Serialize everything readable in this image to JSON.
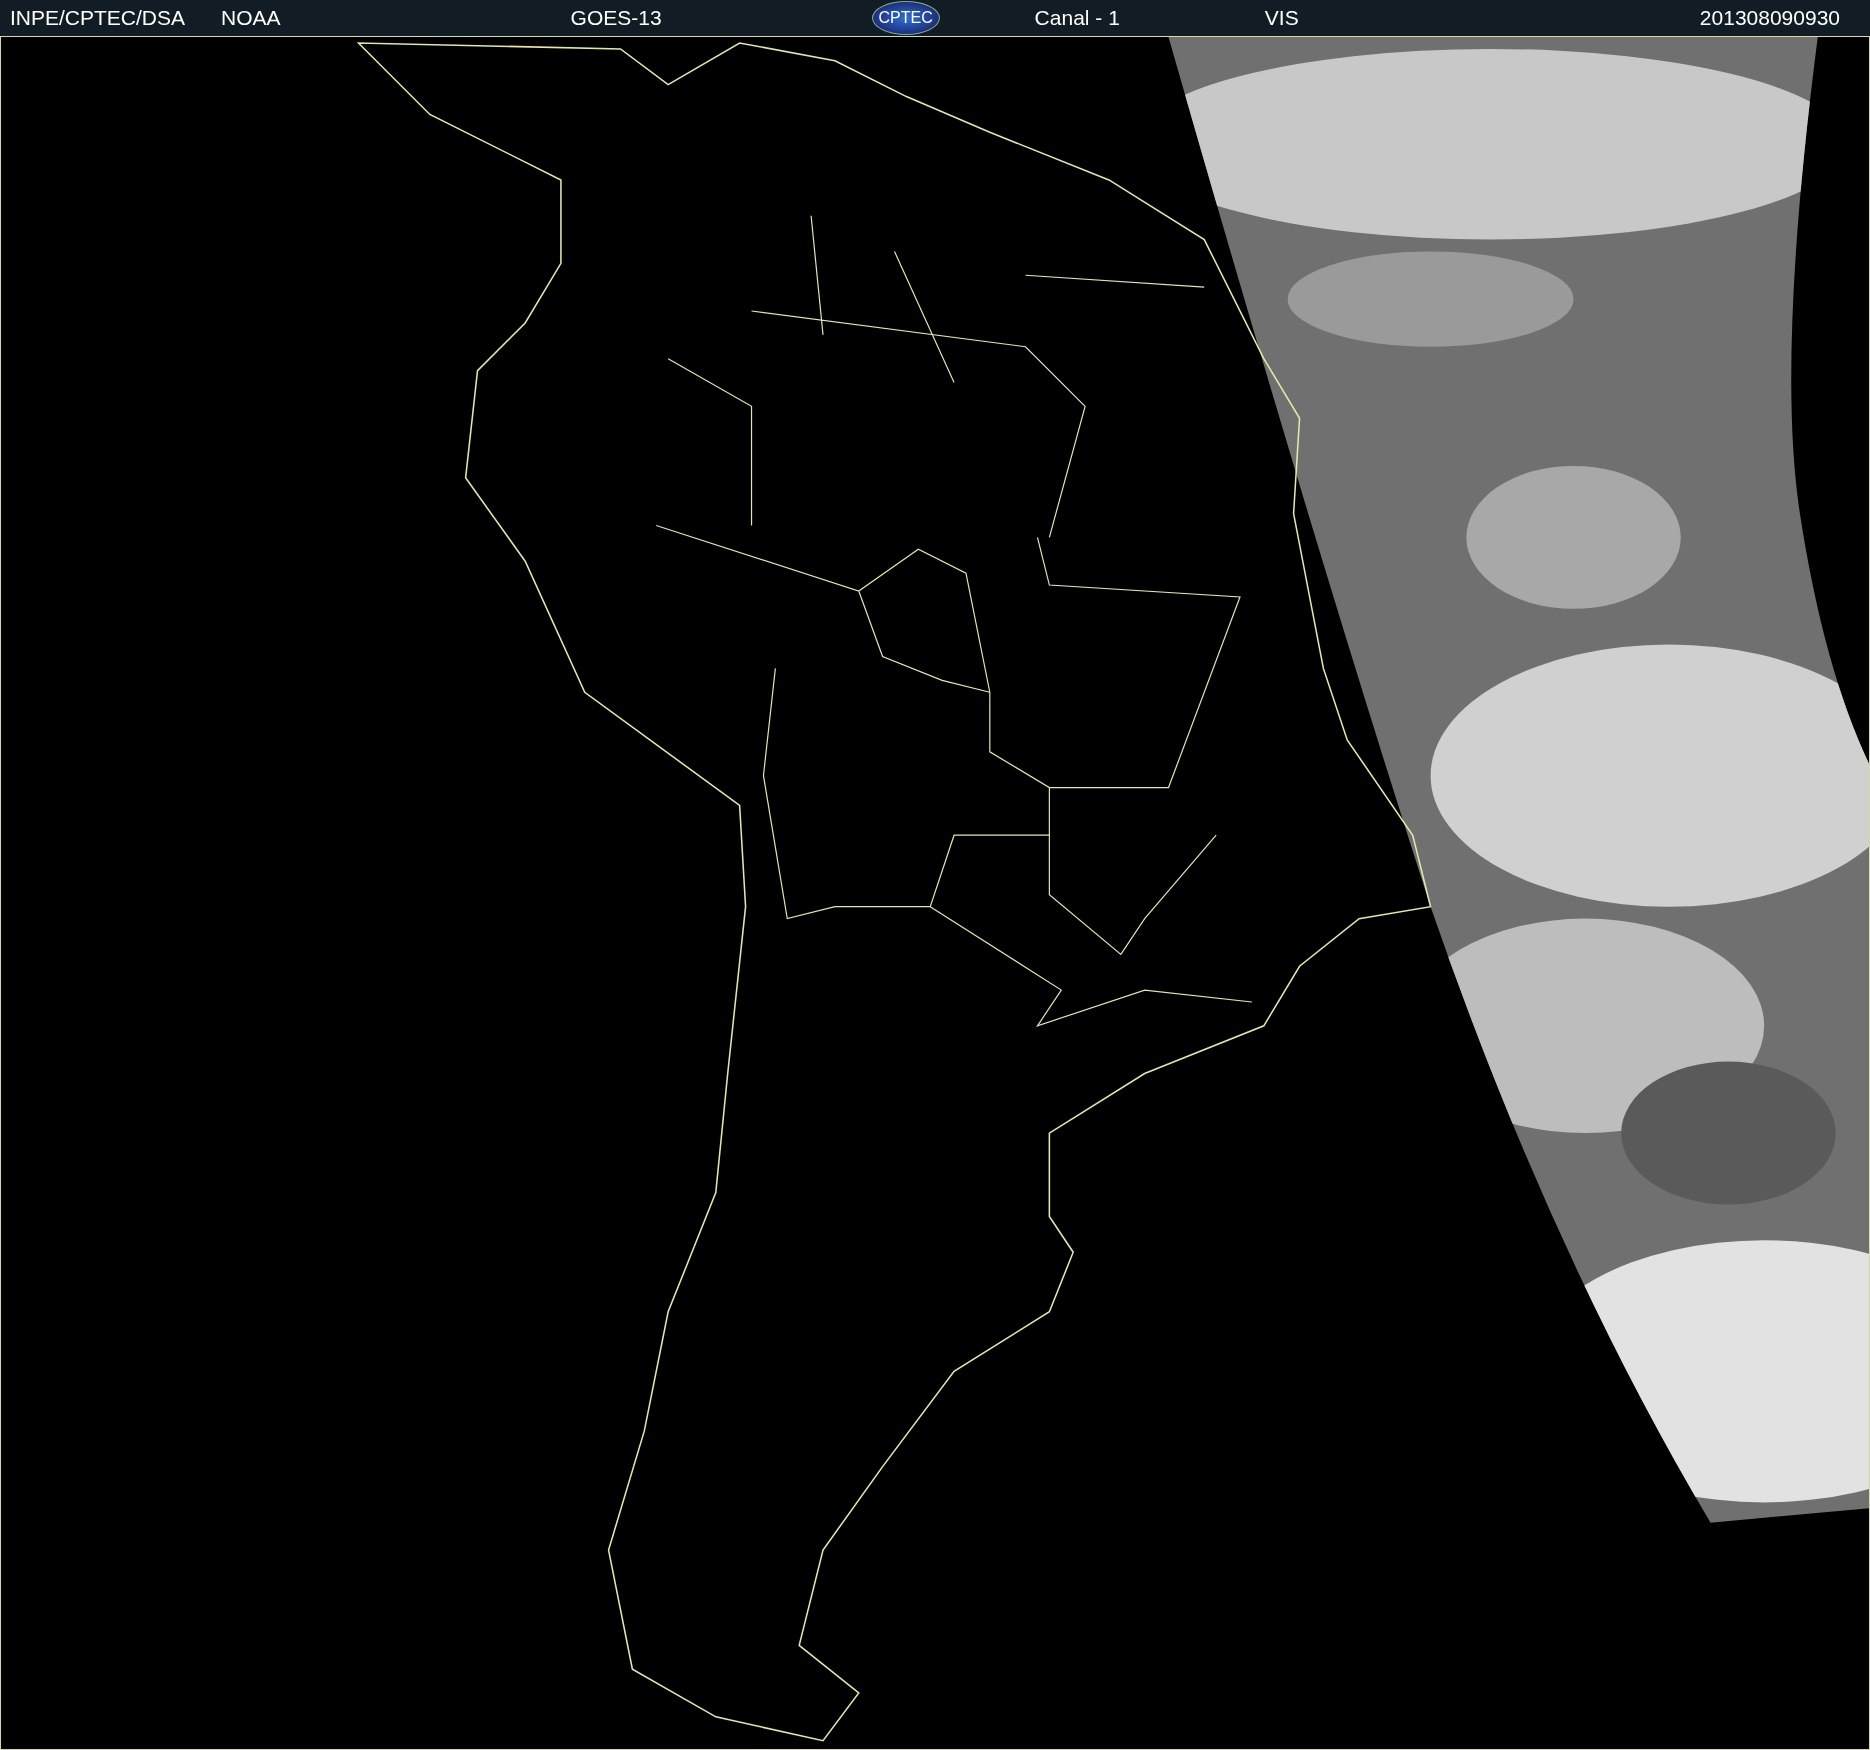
{
  "header": {
    "items": [
      {
        "kind": "text",
        "text": "INPE/CPTEC/DSA"
      },
      {
        "kind": "text",
        "text": "NOAA"
      },
      {
        "kind": "text",
        "text": "GOES-13"
      },
      {
        "kind": "logo",
        "text": "CPTEC"
      },
      {
        "kind": "text",
        "text": "Canal - 1"
      },
      {
        "kind": "text",
        "text": "VIS"
      },
      {
        "kind": "text",
        "text": "201308090930"
      }
    ]
  }
}
